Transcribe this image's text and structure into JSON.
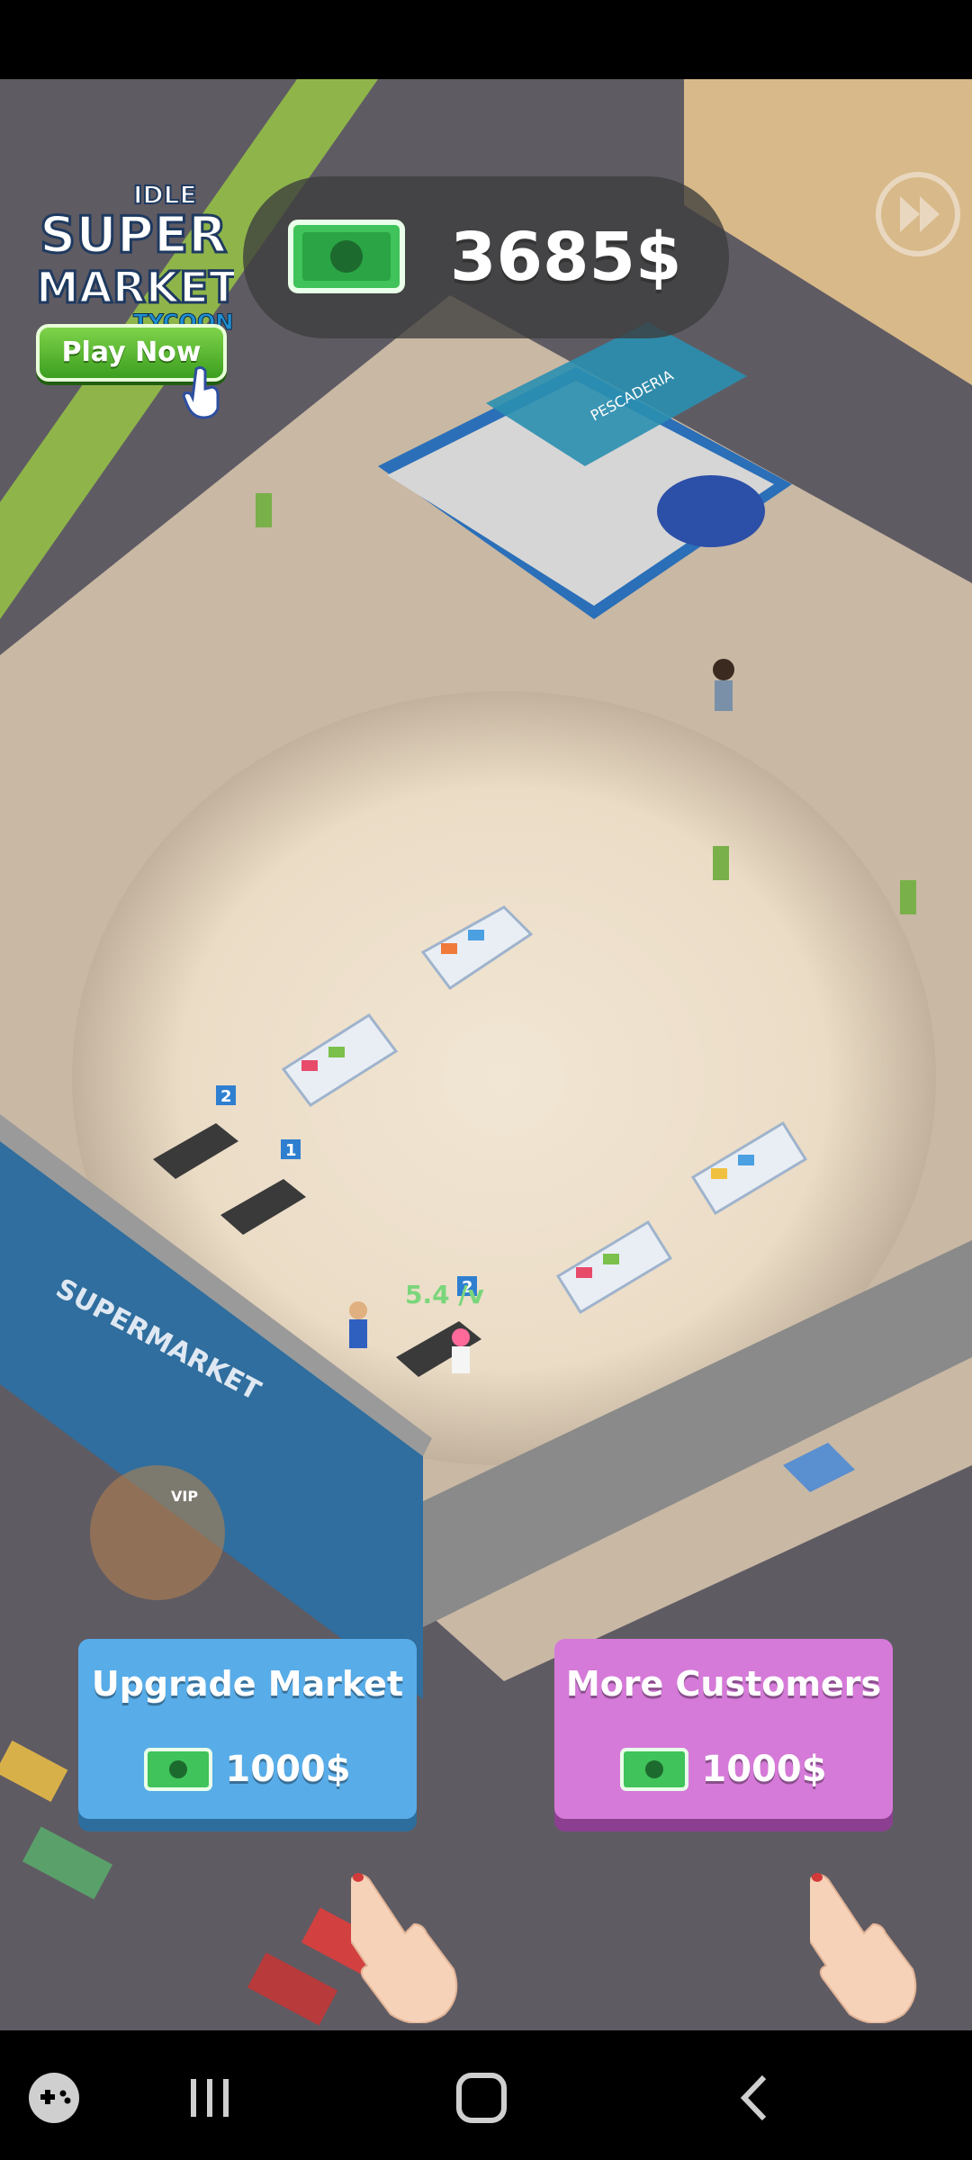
{
  "game": {
    "logo": {
      "line1": "IDLE",
      "line2": "SUPER",
      "line3": "MARKET",
      "line4": "TYCOON"
    },
    "play_now_label": "Play Now",
    "money": "3685$",
    "store_sign": "SUPERMARKET",
    "fish_shop_sign": "PESCADERIA",
    "vip_label": "VIP",
    "floating_income": "5.4 /v",
    "checkout_numbers": [
      "2",
      "1",
      "2"
    ]
  },
  "actions": {
    "upgrade": {
      "title": "Upgrade Market",
      "price": "1000$"
    },
    "customers": {
      "title": "More Customers",
      "price": "1000$"
    }
  },
  "colors": {
    "upgrade_card": "#58ace8",
    "customers_card": "#d57ad8",
    "floor": "#e0cdb4",
    "cash_green": "#3fc35a"
  },
  "icons": {
    "cash": "cash-icon",
    "skip": "fast-forward-icon",
    "hand": "hand-pointer-icon",
    "nav_game": "game-controller-icon",
    "nav_recents": "recents-icon",
    "nav_home": "home-icon",
    "nav_back": "back-icon"
  }
}
